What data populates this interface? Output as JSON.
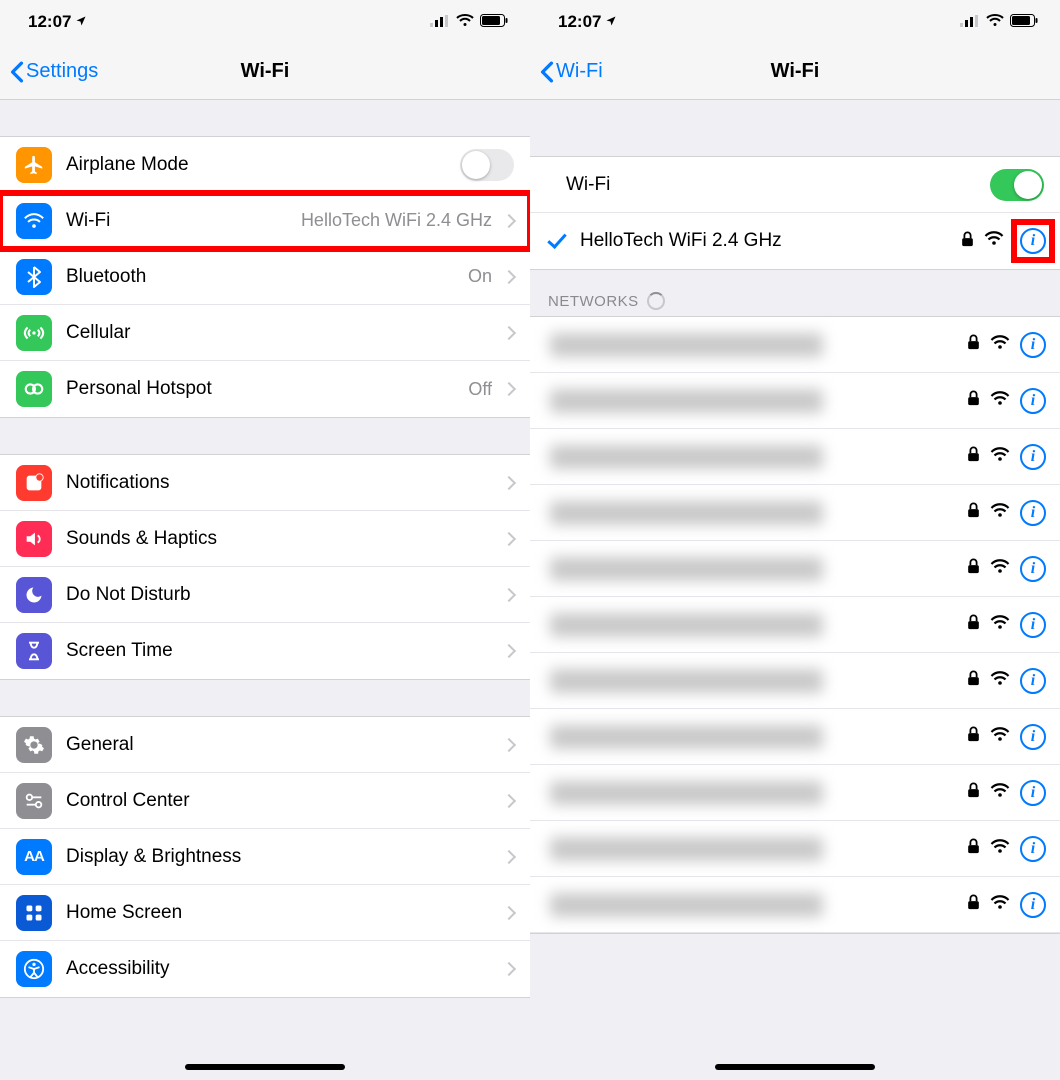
{
  "status": {
    "time": "12:07"
  },
  "left": {
    "back": "Settings",
    "title": "Wi-Fi",
    "group1": {
      "airplane": "Airplane Mode",
      "wifi": "Wi-Fi",
      "wifi_detail": "HelloTech WiFi 2.4 GHz",
      "bluetooth": "Bluetooth",
      "bluetooth_detail": "On",
      "cellular": "Cellular",
      "hotspot": "Personal Hotspot",
      "hotspot_detail": "Off"
    },
    "group2": {
      "notifications": "Notifications",
      "sounds": "Sounds & Haptics",
      "dnd": "Do Not Disturb",
      "screentime": "Screen Time"
    },
    "group3": {
      "general": "General",
      "controlcenter": "Control Center",
      "display": "Display & Brightness",
      "homescreen": "Home Screen",
      "accessibility": "Accessibility"
    }
  },
  "right": {
    "back": "Wi-Fi",
    "title": "Wi-Fi",
    "wifi_label": "Wi-Fi",
    "connected": "HelloTech WiFi 2.4 GHz",
    "networks_header": "NETWORKS",
    "network_count": 11
  }
}
